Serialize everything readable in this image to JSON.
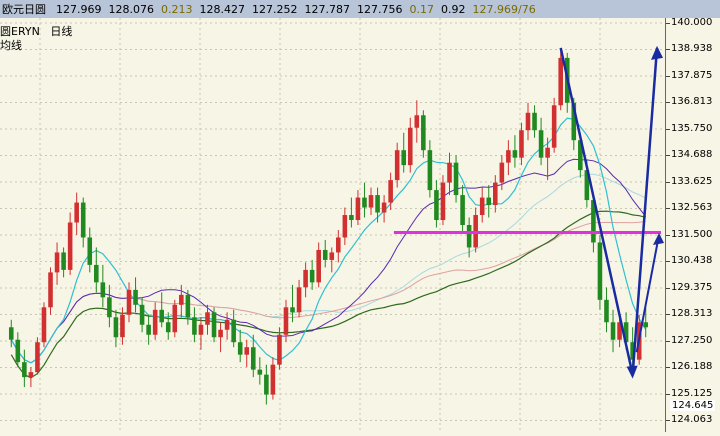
{
  "topbar": {
    "title": "欧元日圆",
    "values": [
      "127.969",
      "128.076",
      "0.213",
      "128.427",
      "127.252",
      "127.787",
      "127.756",
      "0.17",
      "0.92",
      "127.969/76"
    ]
  },
  "legend": {
    "symbol": "圆ERYN",
    "period": "日线",
    "indicator": "均线"
  },
  "chart_data": {
    "type": "candlestick",
    "ylim": [
      123.6,
      140.2
    ],
    "y_ticks": [
      "140.000",
      "138.938",
      "137.875",
      "136.813",
      "135.750",
      "134.688",
      "133.625",
      "132.563",
      "131.500",
      "130.438",
      "129.375",
      "128.313",
      "127.250",
      "126.188",
      "125.125",
      "124.063"
    ],
    "current_price": "124.645",
    "colors": {
      "up": "#d03030",
      "down": "#208a20",
      "ma_short": "#30c0d0",
      "ma_mid": "#5a2ab0",
      "ma_long": "#2e6a1e",
      "ma_light": "#a8d8e0",
      "ma_pink": "#e0a0a0",
      "support": "#e030e0",
      "arrow": "#1a2aa0"
    },
    "support_level": 131.6,
    "bars": [
      [
        127.8,
        128.1,
        127.0,
        127.3
      ],
      [
        127.3,
        127.6,
        126.2,
        126.4
      ],
      [
        126.4,
        126.9,
        125.4,
        125.8
      ],
      [
        125.8,
        126.2,
        125.4,
        126.0
      ],
      [
        126.0,
        127.4,
        125.9,
        127.2
      ],
      [
        127.2,
        128.8,
        127.0,
        128.6
      ],
      [
        128.6,
        130.2,
        128.3,
        130.0
      ],
      [
        130.0,
        131.2,
        129.5,
        130.8
      ],
      [
        130.8,
        131.0,
        129.8,
        130.1
      ],
      [
        130.1,
        132.4,
        129.9,
        132.0
      ],
      [
        132.0,
        133.2,
        131.5,
        132.8
      ],
      [
        132.8,
        133.0,
        131.0,
        131.4
      ],
      [
        131.4,
        131.8,
        130.0,
        130.3
      ],
      [
        130.3,
        131.0,
        129.2,
        129.6
      ],
      [
        129.6,
        130.3,
        128.6,
        129.0
      ],
      [
        129.0,
        129.5,
        127.8,
        128.2
      ],
      [
        128.2,
        128.5,
        127.0,
        127.4
      ],
      [
        127.4,
        128.6,
        127.1,
        128.3
      ],
      [
        128.3,
        129.6,
        128.0,
        129.3
      ],
      [
        129.3,
        129.8,
        128.4,
        128.7
      ],
      [
        128.7,
        129.0,
        127.6,
        127.9
      ],
      [
        127.9,
        128.3,
        127.1,
        127.5
      ],
      [
        127.5,
        128.8,
        127.3,
        128.5
      ],
      [
        128.5,
        129.2,
        127.8,
        128.0
      ],
      [
        128.0,
        128.4,
        127.3,
        127.6
      ],
      [
        127.6,
        128.9,
        127.4,
        128.7
      ],
      [
        128.7,
        129.5,
        128.2,
        129.1
      ],
      [
        129.1,
        129.3,
        127.9,
        128.2
      ],
      [
        128.2,
        128.6,
        127.2,
        127.5
      ],
      [
        127.5,
        128.2,
        126.9,
        127.9
      ],
      [
        127.9,
        128.7,
        127.5,
        128.4
      ],
      [
        128.4,
        128.6,
        127.2,
        127.4
      ],
      [
        127.4,
        128.0,
        126.8,
        127.7
      ],
      [
        127.7,
        128.4,
        127.3,
        128.1
      ],
      [
        128.1,
        128.5,
        127.0,
        127.2
      ],
      [
        127.2,
        127.7,
        126.4,
        126.7
      ],
      [
        126.7,
        127.3,
        126.2,
        127.0
      ],
      [
        127.0,
        127.5,
        125.8,
        126.1
      ],
      [
        126.1,
        126.6,
        125.5,
        125.9
      ],
      [
        125.9,
        126.3,
        124.7,
        125.1
      ],
      [
        125.1,
        126.6,
        124.9,
        126.3
      ],
      [
        126.3,
        127.8,
        126.1,
        127.5
      ],
      [
        127.5,
        128.9,
        127.2,
        128.6
      ],
      [
        128.6,
        129.5,
        128.0,
        128.4
      ],
      [
        128.4,
        129.7,
        128.2,
        129.4
      ],
      [
        129.4,
        130.4,
        129.0,
        130.1
      ],
      [
        130.1,
        130.5,
        129.3,
        129.6
      ],
      [
        129.6,
        131.2,
        129.4,
        130.9
      ],
      [
        130.9,
        131.3,
        130.2,
        130.5
      ],
      [
        130.5,
        131.0,
        130.0,
        130.8
      ],
      [
        130.8,
        131.7,
        130.4,
        131.4
      ],
      [
        131.4,
        132.6,
        131.1,
        132.3
      ],
      [
        132.3,
        133.0,
        131.8,
        132.1
      ],
      [
        132.1,
        133.3,
        131.9,
        133.0
      ],
      [
        133.0,
        133.6,
        132.2,
        132.6
      ],
      [
        132.6,
        133.4,
        132.3,
        133.1
      ],
      [
        133.1,
        133.4,
        132.0,
        132.4
      ],
      [
        132.4,
        133.1,
        132.0,
        132.8
      ],
      [
        132.8,
        134.0,
        132.5,
        133.7
      ],
      [
        133.7,
        135.2,
        133.4,
        134.9
      ],
      [
        134.9,
        135.6,
        134.0,
        134.3
      ],
      [
        134.3,
        136.2,
        134.0,
        135.8
      ],
      [
        135.8,
        136.9,
        135.2,
        136.3
      ],
      [
        136.3,
        136.5,
        134.6,
        134.9
      ],
      [
        134.9,
        135.3,
        133.0,
        133.3
      ],
      [
        133.3,
        133.7,
        131.8,
        132.1
      ],
      [
        132.1,
        133.9,
        131.9,
        133.6
      ],
      [
        133.6,
        134.8,
        133.1,
        134.4
      ],
      [
        134.4,
        134.7,
        132.8,
        133.1
      ],
      [
        133.1,
        133.5,
        131.6,
        131.9
      ],
      [
        131.9,
        132.2,
        130.6,
        131.0
      ],
      [
        131.0,
        132.6,
        130.8,
        132.3
      ],
      [
        132.3,
        133.4,
        132.0,
        133.0
      ],
      [
        133.0,
        133.5,
        132.2,
        132.7
      ],
      [
        132.7,
        133.9,
        132.4,
        133.6
      ],
      [
        133.6,
        134.7,
        133.3,
        134.4
      ],
      [
        134.4,
        135.3,
        133.9,
        134.9
      ],
      [
        134.9,
        135.5,
        134.2,
        134.6
      ],
      [
        134.6,
        136.0,
        134.3,
        135.7
      ],
      [
        135.7,
        136.8,
        135.3,
        136.4
      ],
      [
        136.4,
        136.7,
        135.4,
        135.7
      ],
      [
        135.7,
        136.2,
        134.3,
        134.6
      ],
      [
        134.6,
        135.4,
        133.7,
        135.0
      ],
      [
        135.0,
        137.0,
        134.8,
        136.7
      ],
      [
        136.7,
        139.0,
        136.5,
        138.6
      ],
      [
        138.6,
        138.8,
        136.4,
        136.8
      ],
      [
        136.8,
        137.0,
        134.9,
        135.3
      ],
      [
        135.3,
        135.6,
        133.8,
        134.1
      ],
      [
        134.1,
        134.5,
        132.6,
        132.9
      ],
      [
        132.9,
        133.2,
        130.8,
        131.2
      ],
      [
        131.2,
        131.5,
        128.5,
        128.9
      ],
      [
        128.9,
        129.4,
        127.6,
        128.0
      ],
      [
        128.0,
        128.5,
        126.8,
        127.3
      ],
      [
        127.3,
        128.3,
        127.0,
        128.0
      ],
      [
        128.0,
        128.4,
        126.9,
        127.2
      ],
      [
        127.2,
        127.8,
        126.2,
        126.5
      ],
      [
        126.5,
        128.3,
        126.3,
        128.0
      ],
      [
        128.0,
        128.6,
        127.4,
        127.8
      ]
    ]
  }
}
